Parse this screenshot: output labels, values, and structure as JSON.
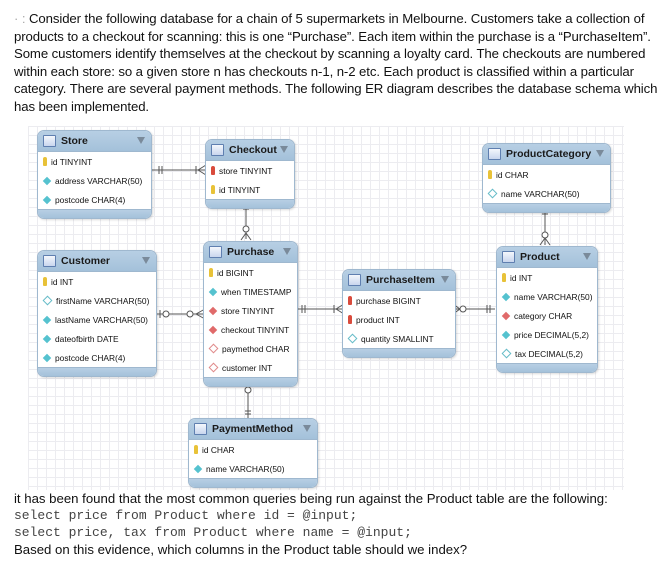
{
  "intro": {
    "marker": "· :",
    "text": " Consider the following database for a chain of 5 supermarkets in Melbourne. Customers take a collection of products to a checkout for scanning: this is one “Purchase”. Each item within the purchase is a “PurchaseItem”. Some customers identify themselves at the checkout by scanning a loyalty card. The checkouts are numbered within each store: so a given store n has checkouts n-1, n-2 etc. Each product is classified within a particular category. There are several payment methods. The following ER diagram describes the database schema which has been implemented."
  },
  "entities": {
    "store": {
      "title": "Store",
      "columns": [
        {
          "icon": "primary-key-icon",
          "label": "id TINYINT"
        },
        {
          "icon": "not-null-column-icon",
          "label": "address VARCHAR(50)"
        },
        {
          "icon": "not-null-column-icon",
          "label": "postcode CHAR(4)"
        }
      ]
    },
    "checkout": {
      "title": "Checkout",
      "columns": [
        {
          "icon": "foreign-primary-key-icon",
          "label": "store TINYINT"
        },
        {
          "icon": "primary-key-icon",
          "label": "id TINYINT"
        }
      ]
    },
    "productcategory": {
      "title": "ProductCategory",
      "columns": [
        {
          "icon": "primary-key-icon",
          "label": "id CHAR"
        },
        {
          "icon": "nullable-column-icon",
          "label": "name VARCHAR(50)"
        }
      ]
    },
    "customer": {
      "title": "Customer",
      "columns": [
        {
          "icon": "primary-key-icon",
          "label": "id INT"
        },
        {
          "icon": "nullable-column-icon",
          "label": "firstName VARCHAR(50)"
        },
        {
          "icon": "not-null-column-icon",
          "label": "lastName VARCHAR(50)"
        },
        {
          "icon": "not-null-column-icon",
          "label": "dateofbirth DATE"
        },
        {
          "icon": "not-null-column-icon",
          "label": "postcode CHAR(4)"
        }
      ]
    },
    "purchase": {
      "title": "Purchase",
      "columns": [
        {
          "icon": "primary-key-icon",
          "label": "id BIGINT"
        },
        {
          "icon": "not-null-column-icon",
          "label": "when TIMESTAMP"
        },
        {
          "icon": "foreign-key-icon",
          "label": "store TINYINT"
        },
        {
          "icon": "foreign-key-icon",
          "label": "checkout TINYINT"
        },
        {
          "icon": "nullable-foreign-key-icon",
          "label": "paymethod CHAR"
        },
        {
          "icon": "nullable-foreign-key-icon",
          "label": "customer INT"
        }
      ]
    },
    "purchaseitem": {
      "title": "PurchaseItem",
      "columns": [
        {
          "icon": "foreign-primary-key-icon",
          "label": "purchase BIGINT"
        },
        {
          "icon": "foreign-primary-key-icon",
          "label": "product INT"
        },
        {
          "icon": "nullable-column-icon",
          "label": "quantity SMALLINT"
        }
      ]
    },
    "product": {
      "title": "Product",
      "columns": [
        {
          "icon": "primary-key-icon",
          "label": "id INT"
        },
        {
          "icon": "not-null-column-icon",
          "label": "name VARCHAR(50)"
        },
        {
          "icon": "foreign-key-icon",
          "label": "category CHAR"
        },
        {
          "icon": "not-null-column-icon",
          "label": "price DECIMAL(5,2)"
        },
        {
          "icon": "nullable-column-icon",
          "label": "tax DECIMAL(5,2)"
        }
      ]
    },
    "paymentmethod": {
      "title": "PaymentMethod",
      "columns": [
        {
          "icon": "primary-key-icon",
          "label": "id CHAR"
        },
        {
          "icon": "not-null-column-icon",
          "label": "name VARCHAR(50)"
        }
      ]
    }
  },
  "relationships": [
    {
      "from": "Store",
      "to": "Checkout",
      "from_card": "one-and-only-one",
      "to_card": "one-or-many"
    },
    {
      "from": "Checkout",
      "to": "Purchase",
      "from_card": "one-and-only-one",
      "to_card": "zero-or-many"
    },
    {
      "from": "Customer",
      "to": "Purchase",
      "from_card": "zero-or-one",
      "to_card": "zero-or-many"
    },
    {
      "from": "Purchase",
      "to": "PurchaseItem",
      "from_card": "one-and-only-one",
      "to_card": "one-or-many"
    },
    {
      "from": "Product",
      "to": "PurchaseItem",
      "from_card": "one-and-only-one",
      "to_card": "zero-or-many"
    },
    {
      "from": "ProductCategory",
      "to": "Product",
      "from_card": "one-and-only-one",
      "to_card": "zero-or-many"
    },
    {
      "from": "PaymentMethod",
      "to": "Purchase",
      "from_card": "one-and-only-one",
      "to_card": "zero-or-many"
    }
  ],
  "outro": {
    "line1": "it has been found that the most common queries being run against the Product table are the following:",
    "query1": "select price from Product where id = @input;",
    "query2": "select price, tax from Product where name = @input;",
    "question": "Based on this evidence, which columns in the Product table should we index?"
  },
  "colors": {
    "header": "#a9c5de",
    "border": "#9fb8cf",
    "primary_key": "#e8c238",
    "foreign_key": "#d94b3c",
    "column": "#55c2cf"
  }
}
